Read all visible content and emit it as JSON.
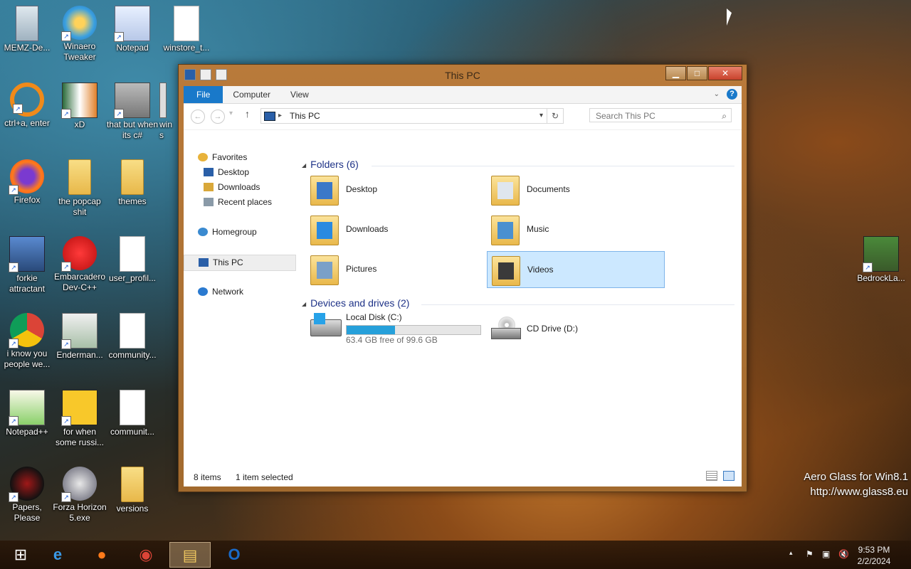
{
  "desktop": {
    "icons": [
      {
        "label": "MEMZ-De...",
        "kind": "recycle-bin-icon"
      },
      {
        "label": "Winaero Tweaker",
        "kind": "winaero-icon"
      },
      {
        "label": "Notepad",
        "kind": "notepad-icon"
      },
      {
        "label": "winstore_t...",
        "kind": "document-icon"
      },
      {
        "label": "ctrl+a, enter",
        "kind": "ring-icon"
      },
      {
        "label": "xD",
        "kind": "xd-icon"
      },
      {
        "label": "that but when its c#",
        "kind": "windows-stack-icon"
      },
      {
        "label": "wins",
        "kind": "window-icon"
      },
      {
        "label": "Firefox",
        "kind": "firefox-icon"
      },
      {
        "label": "the popcap shit",
        "kind": "folder-icon"
      },
      {
        "label": "themes",
        "kind": "folder-icon"
      },
      {
        "label": "forkie attractant",
        "kind": "settings-monitor-icon"
      },
      {
        "label": "Embarcadero Dev-C++",
        "kind": "devcpp-icon"
      },
      {
        "label": "user_profil...",
        "kind": "document-icon"
      },
      {
        "label": "i know you people we...",
        "kind": "chrome-icon"
      },
      {
        "label": "Enderman...",
        "kind": "image-icon"
      },
      {
        "label": "community...",
        "kind": "document-icon"
      },
      {
        "label": "Notepad++",
        "kind": "notepadpp-icon"
      },
      {
        "label": "for when some russi...",
        "kind": "de-icon"
      },
      {
        "label": "communit...",
        "kind": "document-icon"
      },
      {
        "label": "Papers, Please",
        "kind": "papers-please-icon"
      },
      {
        "label": "Forza Horizon 5.exe",
        "kind": "flash-icon"
      },
      {
        "label": "versions",
        "kind": "folder-icon"
      },
      {
        "label": "BedrockLa...",
        "kind": "minecraft-icon"
      }
    ]
  },
  "window": {
    "title": "This PC",
    "buttons": {
      "minimize": "▁",
      "maximize": "□",
      "close": "✕"
    },
    "ribbon_tabs": [
      "File",
      "Computer",
      "View"
    ],
    "help": "?",
    "address": {
      "crumb": "This PC",
      "separator": "▸",
      "dropdown": "▾",
      "refresh": "↻"
    },
    "search": {
      "placeholder": "Search This PC",
      "icon": "⌕"
    },
    "nav": [
      {
        "label": "Favorites",
        "icon": "star-icon",
        "color": "#e8b23a"
      },
      {
        "label": "Desktop",
        "icon": "desktop-icon",
        "color": "#2a5fa8"
      },
      {
        "label": "Downloads",
        "icon": "downloads-icon",
        "color": "#d9a83a"
      },
      {
        "label": "Recent places",
        "icon": "recent-places-icon",
        "color": "#8a9aa8"
      },
      {
        "label": "Homegroup",
        "icon": "homegroup-icon",
        "color": "#3a8ad0"
      },
      {
        "label": "This PC",
        "icon": "computer-icon",
        "color": "#2a5fa8"
      },
      {
        "label": "Network",
        "icon": "network-icon",
        "color": "#2a7ad0"
      }
    ],
    "groups": {
      "folders": "Folders (6)",
      "drives": "Devices and drives (2)"
    },
    "folders": [
      {
        "name": "Desktop",
        "overlay": "#3a78c8"
      },
      {
        "name": "Documents",
        "overlay": "#dfe6ee"
      },
      {
        "name": "Downloads",
        "overlay": "#2a8ae0"
      },
      {
        "name": "Music",
        "overlay": "#4a90d0"
      },
      {
        "name": "Pictures",
        "overlay": "#7aa0c8"
      },
      {
        "name": "Videos",
        "overlay": "#3a3a3a",
        "selected": true
      }
    ],
    "drives": [
      {
        "name": "Local Disk (C:)",
        "free_text": "63.4 GB free of 99.6 GB",
        "used_fraction": 0.363
      },
      {
        "name": "CD Drive (D:)"
      }
    ],
    "status": {
      "items": "8 items",
      "selected": "1 item selected"
    }
  },
  "taskbar": {
    "apps": [
      {
        "name": "start-button",
        "glyph": "⊞"
      },
      {
        "name": "internet-explorer",
        "glyph": "e"
      },
      {
        "name": "firefox",
        "glyph": "●"
      },
      {
        "name": "chrome",
        "glyph": "◉"
      },
      {
        "name": "file-explorer",
        "glyph": "▤",
        "active": true
      },
      {
        "name": "outlook",
        "glyph": "O"
      }
    ],
    "tray": {
      "chevron": "▴",
      "flag": "⚑",
      "network": "▣",
      "volume": "🔇"
    },
    "time": "9:53 PM",
    "date": "2/2/2024"
  },
  "watermark": {
    "line1": "Aero Glass for Win8.1",
    "line2": "http://www.glass8.eu"
  },
  "colors": {
    "accent": "#1979ca",
    "selection": "#cce8ff",
    "frame": "#b97a3a"
  }
}
